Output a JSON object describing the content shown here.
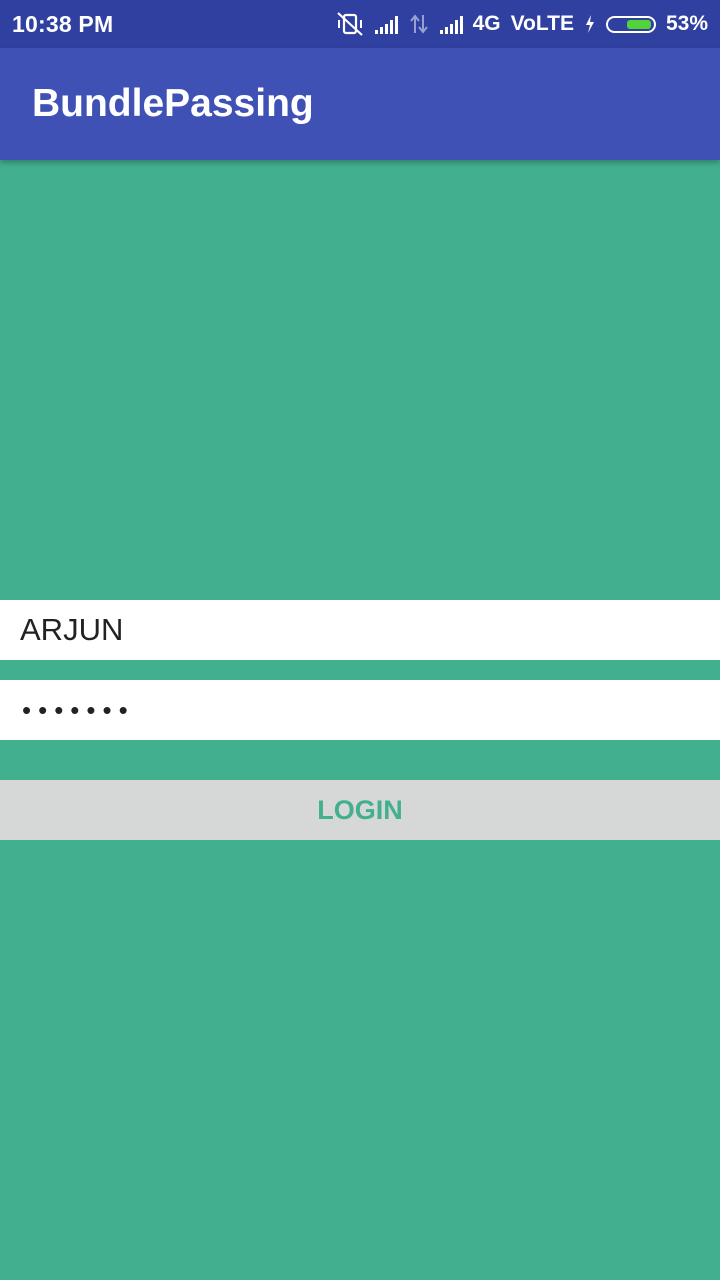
{
  "status_bar": {
    "time": "10:38 PM",
    "network": "4G",
    "volte": "VoLTE",
    "battery": "53%",
    "battery_level": 0.53,
    "icons": [
      "vibrate-off-icon",
      "signal-icon",
      "data-arrows-icon",
      "signal-icon",
      "charging-icon",
      "battery-icon"
    ]
  },
  "app_bar": {
    "title": "BundlePassing"
  },
  "form": {
    "username_value": "ARJUN",
    "password_value": "•••••••",
    "login_label": "LOGIN"
  },
  "colors": {
    "status_bar": "#3040a0",
    "app_bar": "#3f51b5",
    "background": "#42b08f",
    "button_bg": "#d6d7d7",
    "button_text": "#42b08f"
  }
}
